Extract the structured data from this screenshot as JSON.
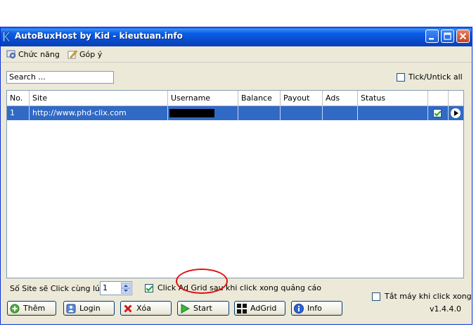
{
  "window": {
    "title": "AutoBuxHost by Kid - kieutuan.info",
    "accent": "#0a5ee8"
  },
  "menu": {
    "items": [
      {
        "label": "Chức năng",
        "icon": "gear-icon"
      },
      {
        "label": "Góp ý",
        "icon": "pencil-icon"
      }
    ]
  },
  "search": {
    "value": "Search ..."
  },
  "tick_all": {
    "label": "Tick/Untick all",
    "checked": false
  },
  "table": {
    "columns": [
      "No.",
      "Site",
      "Username",
      "Balance",
      "Payout",
      "Ads",
      "Status"
    ],
    "rows": [
      {
        "no": "1",
        "site": "http://www.phd-clix.com",
        "username": "",
        "balance": "",
        "payout": "",
        "ads": "",
        "status": "",
        "checked": true
      }
    ],
    "selection_color": "#316ac5"
  },
  "options": {
    "concurrent_label": "Số Site sẽ Click cùng lúc:",
    "concurrent_value": "1",
    "adgrid_label": "Click Ad Grid sau khi click xong quảng cáo",
    "adgrid_checked": true,
    "shutdown_label": "Tắt máy khi click xong",
    "shutdown_checked": false
  },
  "buttons": {
    "add": "Thêm",
    "login": "Login",
    "delete": "Xóa",
    "start": "Start",
    "adgrid": "AdGrid",
    "info": "Info"
  },
  "version": "v1.4.4.0"
}
